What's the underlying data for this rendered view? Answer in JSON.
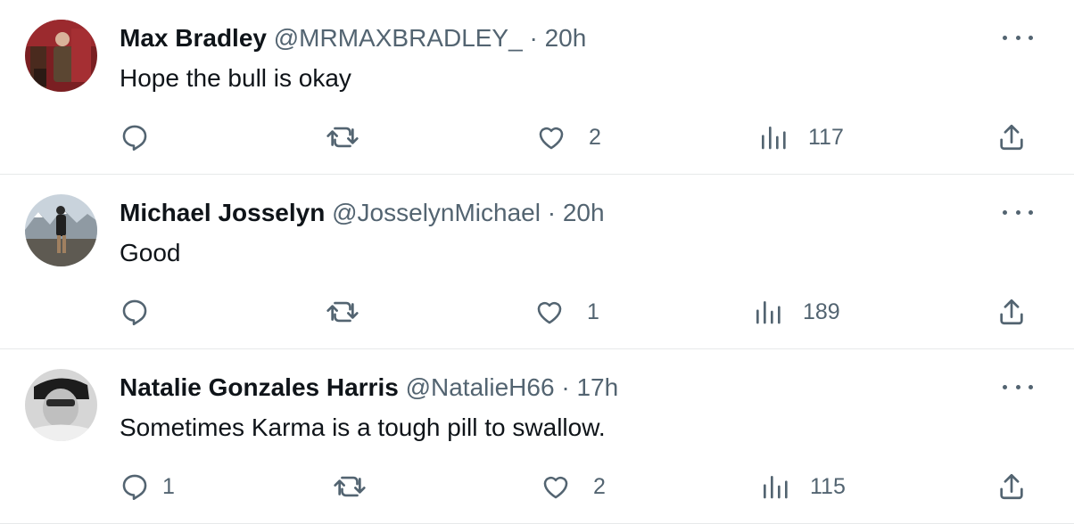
{
  "tweets": [
    {
      "name": "Max Bradley",
      "handle": "@MRMAXBRADLEY_",
      "separator": "·",
      "time": "20h",
      "text": "Hope the bull is okay",
      "replies": "",
      "retweets": "",
      "likes": "2",
      "views": "117",
      "avatar_icon": "avatar-photo"
    },
    {
      "name": "Michael Josselyn",
      "handle": "@JosselynMichael",
      "separator": "·",
      "time": "20h",
      "text": "Good",
      "replies": "",
      "retweets": "",
      "likes": "1",
      "views": "189",
      "avatar_icon": "avatar-photo"
    },
    {
      "name": "Natalie Gonzales Harris",
      "handle": "@NatalieH66",
      "separator": "·",
      "time": "17h",
      "text": "Sometimes Karma is a tough pill to swallow.",
      "replies": "1",
      "retweets": "",
      "likes": "2",
      "views": "115",
      "avatar_icon": "avatar-photo"
    }
  ],
  "colors": {
    "text_primary": "#0f1419",
    "text_secondary": "#536471",
    "divider": "#e7e9ea"
  }
}
